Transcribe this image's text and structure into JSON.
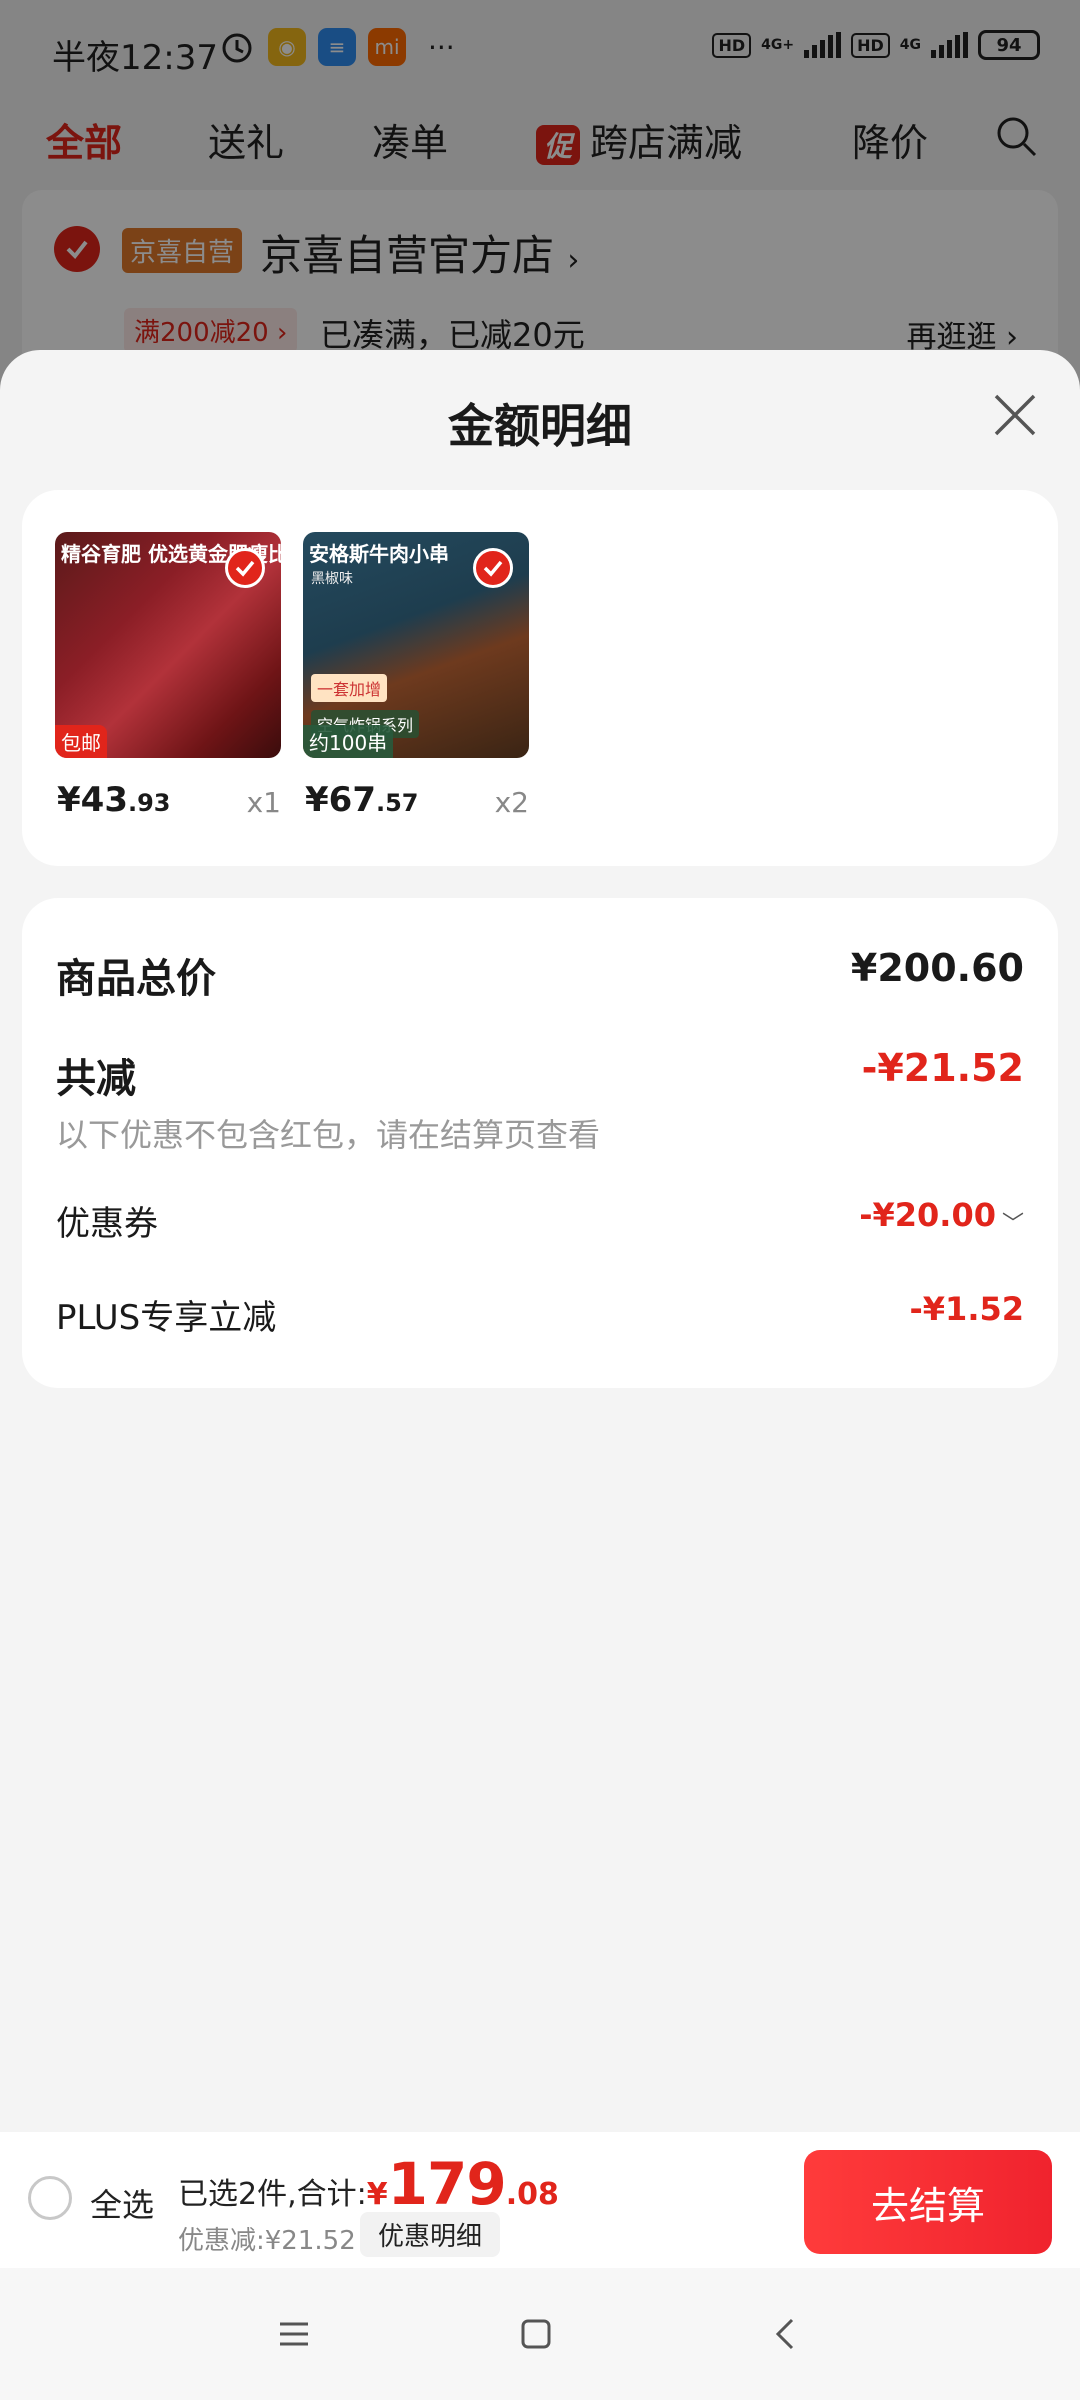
{
  "status_bar": {
    "time": "半夜12:37",
    "battery": "94",
    "network_1": "4G+",
    "network_2": "4G",
    "hd": "HD",
    "dots": "···"
  },
  "tabs": [
    {
      "label": "全部",
      "active": true
    },
    {
      "label": "送礼",
      "active": false
    },
    {
      "label": "凑单",
      "active": false
    },
    {
      "label": "跨店满减",
      "active": false,
      "badge": "促"
    },
    {
      "label": "降价",
      "active": false
    }
  ],
  "store": {
    "tag": "京喜自营",
    "name": "京喜自营官方店",
    "promo_tag": "满200减20",
    "promo_text": "已凑满，已减20元",
    "promo_more": "再逛逛"
  },
  "sheet": {
    "title": "金额明细"
  },
  "products": [
    {
      "img_caption": "精谷育肥 优选黄金肥瘦比",
      "img_badge": "包邮",
      "price_int": "¥43",
      "price_dec": ".93",
      "qty": "x1"
    },
    {
      "img_caption": "安格斯牛肉小串",
      "img_sub": "黑椒味",
      "img_badge": "约100串",
      "img_badge2": "一套加增",
      "img_badge3": "空气炸锅系列",
      "price_int": "¥67",
      "price_dec": ".57",
      "qty": "x2"
    }
  ],
  "details": {
    "total_label": "商品总价",
    "total_value": "¥200.60",
    "discount_label": "共减",
    "discount_value": "-¥21.52",
    "note": "以下优惠不包含红包，请在结算页查看",
    "coupon_label": "优惠券",
    "coupon_value": "-¥20.00",
    "plus_label": "PLUS专享立减",
    "plus_value": "-¥1.52"
  },
  "action_bar": {
    "select_all": "全选",
    "selected_prefix": "已选2件,合计:",
    "currency": "¥",
    "total_int": "179",
    "total_dec": ".08",
    "discount_text": "优惠减:¥21.52",
    "detail_chip": "优惠明细",
    "checkout": "去结算"
  },
  "colors": {
    "brand_red": "#e1251b",
    "background": "#f4f4f4"
  },
  "icons": [
    "search-icon",
    "close-icon",
    "check-icon",
    "menu-icon",
    "home-icon",
    "back-icon",
    "alarm-icon"
  ]
}
